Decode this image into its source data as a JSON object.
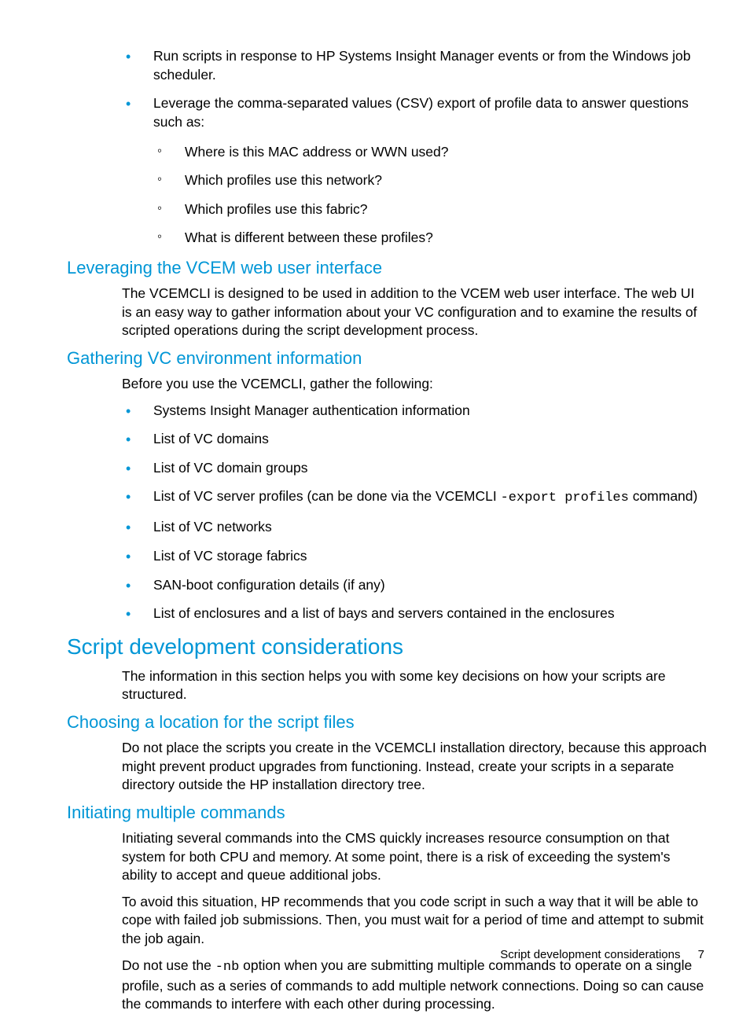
{
  "bullets_top": {
    "b1": "Run scripts in response to HP Systems Insight Manager events or from the Windows job scheduler.",
    "b2": "Leverage the comma-separated values (CSV) export of profile data to answer questions such as:",
    "sub": {
      "s1": "Where is this MAC address or WWN used?",
      "s2": "Which profiles use this network?",
      "s3": "Which profiles use this fabric?",
      "s4": "What is different between these profiles?"
    }
  },
  "section_leverage": {
    "title": "Leveraging the VCEM web user interface",
    "p1": "The VCEMCLI is designed to be used in addition to the VCEM web user interface. The web UI is an easy way to gather information about your VC configuration and to examine the results of scripted operations during the script development process."
  },
  "section_gather": {
    "title": "Gathering VC environment information",
    "p1": "Before you use the VCEMCLI, gather the following:",
    "items": {
      "i1": "Systems Insight Manager authentication information",
      "i2": "List of VC domains",
      "i3": "List of VC domain groups",
      "i4_pre": "List of VC server profiles (can be done via the VCEMCLI ",
      "i4_code": "-export profiles",
      "i4_post": " command)",
      "i5": "List of VC networks",
      "i6": "List of VC storage fabrics",
      "i7": "SAN-boot configuration details (if any)",
      "i8": "List of enclosures and a list of bays and servers contained in the enclosures"
    }
  },
  "section_script": {
    "title": "Script development considerations",
    "p1": "The information in this section helps you with some key decisions on how your scripts are structured."
  },
  "section_choose": {
    "title": "Choosing a location for the script files",
    "p1": "Do not place the scripts you create in the VCEMCLI installation directory, because this approach might prevent product upgrades from functioning. Instead, create your scripts in a separate directory outside the HP installation directory tree."
  },
  "section_init": {
    "title": "Initiating multiple commands",
    "p1": "Initiating several commands into the CMS quickly increases resource consumption on that system for both CPU and memory. At some point, there is a risk of exceeding the system's ability to accept and queue additional jobs.",
    "p2": "To avoid this situation, HP recommends that you code script in such a way that it will be able to cope with failed job submissions. Then, you must wait for a period of time and attempt to submit the job again.",
    "p3_pre": "Do not use the ",
    "p3_code": "-nb",
    "p3_post": " option when you are submitting multiple commands to operate on a single profile, such as a series of commands to add multiple network connections. Doing so can cause the commands to interfere with each other during processing."
  },
  "footer": {
    "text": "Script development considerations",
    "page": "7"
  }
}
